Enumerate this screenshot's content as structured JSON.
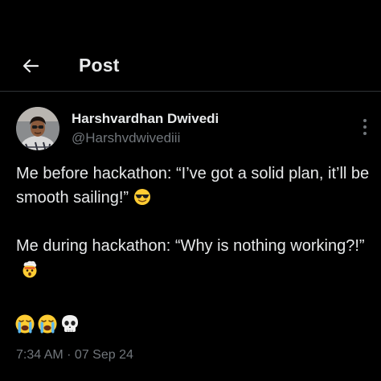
{
  "header": {
    "back_icon": "arrow-left-icon",
    "title": "Post"
  },
  "post": {
    "author": {
      "display_name": "Harshvardhan Dwivedi",
      "handle": "@Harshvdwivediii",
      "avatar_icon": "user-avatar"
    },
    "more_icon": "more-vertical-icon",
    "paragraphs": [
      {
        "text": "Me before hackathon: “I’ve got a solid plan, it’ll be smooth sailing!”",
        "emoji": "smiling-face-with-sunglasses-icon"
      },
      {
        "text": "Me during hackathon: “Why is nothing working?!”",
        "emoji": "exploding-head-icon"
      }
    ],
    "reaction_emojis": [
      "loudly-crying-face-icon",
      "loudly-crying-face-icon",
      "skull-icon"
    ],
    "timestamp": "7:34 AM · 07 Sep 24"
  },
  "colors": {
    "background": "#000000",
    "text_primary": "#e7e9ea",
    "text_secondary": "#71767b",
    "divider": "#2f3336"
  }
}
